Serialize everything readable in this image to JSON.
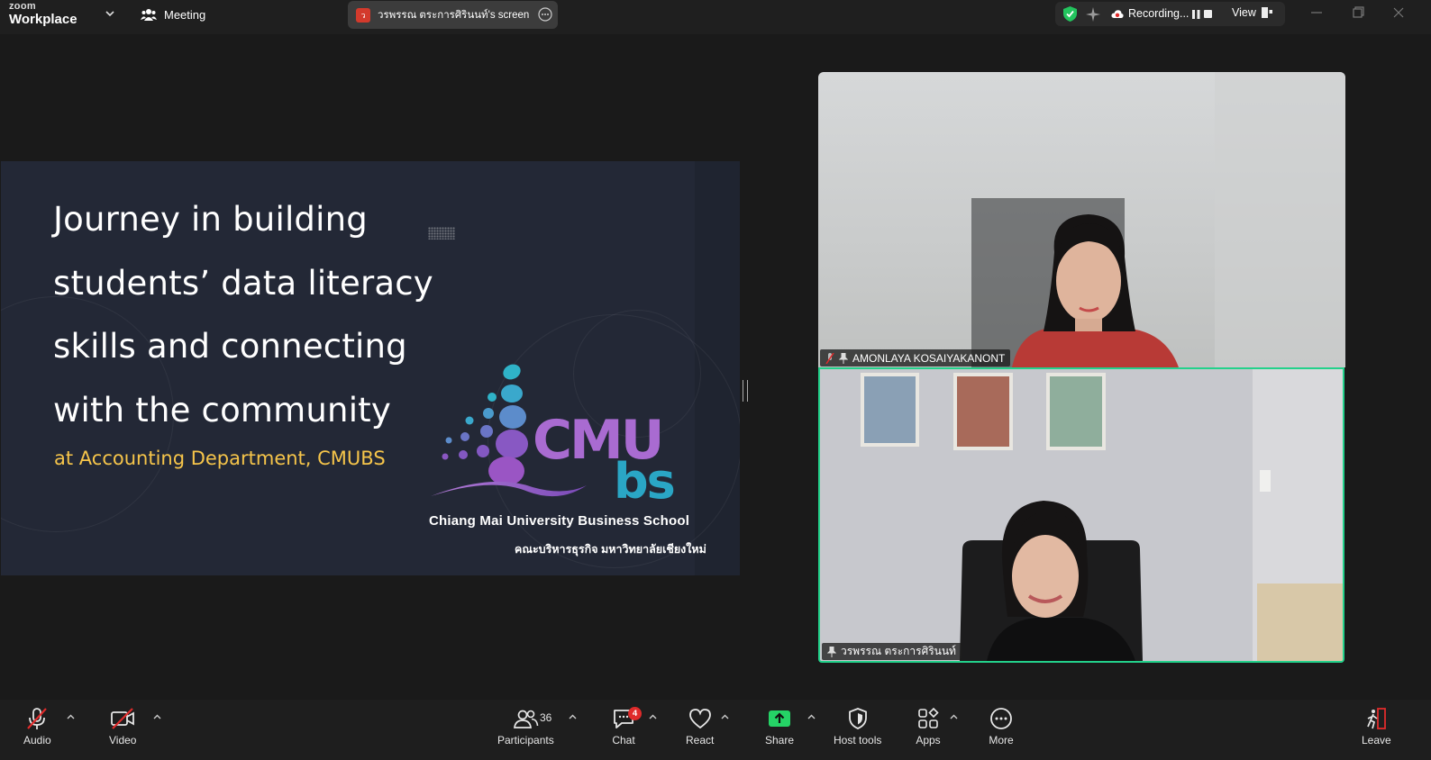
{
  "app": {
    "brand_top": "zoom",
    "brand_bottom": "Workplace",
    "meeting_label": "Meeting"
  },
  "screen_share": {
    "badge_letter": "ว",
    "title": "วรพรรณ ตระการศิรินนท์'s screen"
  },
  "status": {
    "recording_label": "Recording...",
    "view_label": "View"
  },
  "slide": {
    "title_lines": [
      "Journey in building",
      "students’ data literacy",
      "skills and connecting",
      "with the community"
    ],
    "subtitle": "at Accounting Department, CMUBS",
    "logo_top": "CMU",
    "logo_bottom": "bs",
    "school_en": "Chiang Mai University Business School",
    "school_th": "คณะบริหารธุรกิจ  มหาวิทยาลัยเชียงใหม่"
  },
  "participants_video": [
    {
      "name": "AMONLAYA KOSAIYAKANONT"
    },
    {
      "name": "วรพรรณ ตระการศิรินนท์"
    }
  ],
  "toolbar": {
    "audio": "Audio",
    "video": "Video",
    "participants": "Participants",
    "participants_count": "36",
    "chat": "Chat",
    "chat_badge": "4",
    "react": "React",
    "share": "Share",
    "host_tools": "Host tools",
    "apps": "Apps",
    "more": "More",
    "leave": "Leave"
  },
  "colors": {
    "accent_green": "#23d18b",
    "share_green": "#25d466",
    "slide_subtitle": "#f6c54a",
    "danger_red": "#e02b2b"
  }
}
